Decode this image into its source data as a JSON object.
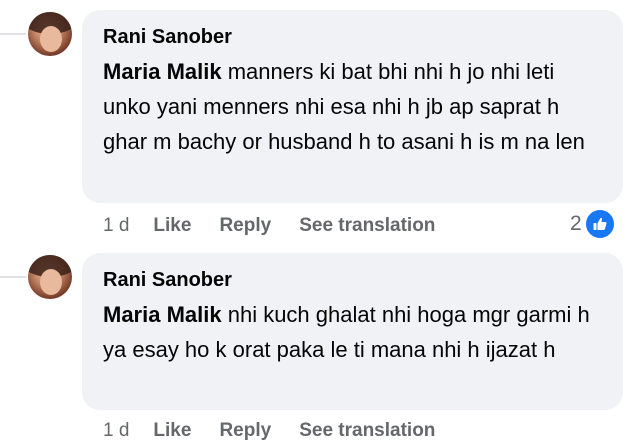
{
  "comments": [
    {
      "author": "Rani Sanober",
      "mention": "Maria Malik",
      "text": " manners ki bat bhi nhi h jo nhi leti unko yani menners nhi esa nhi h jb ap saprat h ghar m bachy or husband h to asani h is m na len",
      "time": "1 d",
      "like_label": "Like",
      "reply_label": "Reply",
      "translate_label": "See translation",
      "reaction_count": "2",
      "reaction_icon": "like-thumb-icon"
    },
    {
      "author": "Rani Sanober",
      "mention": "Maria Malik",
      "text": " nhi kuch ghalat nhi hoga mgr garmi h ya esay ho k orat paka le ti mana nhi h ijazat h",
      "time": "1 d",
      "like_label": "Like",
      "reply_label": "Reply",
      "translate_label": "See translation"
    }
  ],
  "colors": {
    "bubble": "#f0f2f5",
    "meta_text": "#65676b",
    "like_blue": "#1877f2"
  }
}
